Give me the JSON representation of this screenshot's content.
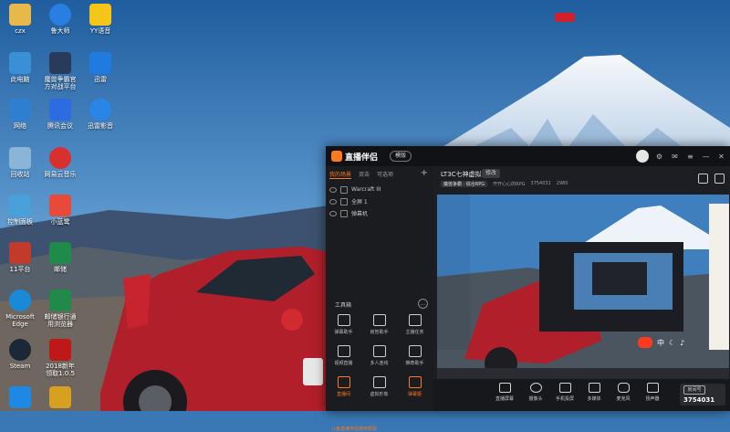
{
  "desktop": {
    "icons_col1": [
      {
        "label": "czx",
        "icon": "folder-icon",
        "color": "#e8b84b"
      },
      {
        "label": "此电脑",
        "icon": "computer-icon",
        "color": "#3a8fd6"
      },
      {
        "label": "网络",
        "icon": "network-icon",
        "color": "#2f7fd0"
      },
      {
        "label": "回收站",
        "icon": "recycle-bin-icon",
        "color": "#8ab4d8"
      },
      {
        "label": "控制面板",
        "icon": "control-panel-icon",
        "color": "#4aa0d8"
      },
      {
        "label": "11平台",
        "icon": "11-platform-icon",
        "color": "#c23b2a"
      },
      {
        "label": "Microsoft\nEdge",
        "icon": "edge-icon",
        "color": "#1a8ad8"
      },
      {
        "label": "Steam",
        "icon": "steam-icon",
        "color": "#1b2838"
      }
    ],
    "icons_col2": [
      {
        "label": "鲁大师",
        "icon": "ludashi-icon",
        "color": "#2a7de1"
      },
      {
        "label": "魔兽争霸官\n方对战平台",
        "icon": "warcraft-icon",
        "color": "#2a3a5a"
      },
      {
        "label": "腾讯会议",
        "icon": "tencent-meeting-icon",
        "color": "#2d6be0"
      },
      {
        "label": "网易云音乐",
        "icon": "netease-music-icon",
        "color": "#d8302f"
      },
      {
        "label": "小蓝鹭",
        "icon": "heron-icon",
        "color": "#e84a3a"
      },
      {
        "label": "邮储",
        "icon": "psbc-icon",
        "color": "#1f8a4a"
      },
      {
        "label": "邮储银行通\n用浏览器",
        "icon": "psbc-browser-icon",
        "color": "#1f8a4a"
      },
      {
        "label": "2018新年\n领取1.0.5",
        "icon": "new-year-icon",
        "color": "#c01818"
      }
    ],
    "icons_col3": [
      {
        "label": "YY语音",
        "icon": "yy-icon",
        "color": "#f5c518"
      },
      {
        "label": "迅雷",
        "icon": "thunder-icon",
        "color": "#1f7be0"
      },
      {
        "label": "迅雷影音",
        "icon": "thunder-player-icon",
        "color": "#2a86e6"
      }
    ],
    "taskbar_partial": [
      {
        "label": "",
        "icon": "qq-browser-icon",
        "color": "#1e88e5"
      },
      {
        "label": "",
        "icon": "csgo-icon",
        "color": "#d8a020"
      }
    ]
  },
  "app": {
    "name": "直播伴侣",
    "title_button": "模版",
    "tabs": [
      {
        "label": "我的场景",
        "active": true
      },
      {
        "label": "双击",
        "active": false
      },
      {
        "label": "可选项",
        "active": false
      }
    ],
    "scenes": [
      {
        "label": "Warcraft III"
      },
      {
        "label": "全屏 1"
      },
      {
        "label": "弹幕机"
      }
    ],
    "toolbox_title": "工具箱",
    "tools": [
      {
        "label": "弹幕助手",
        "hot": false
      },
      {
        "label": "房管助手",
        "hot": false
      },
      {
        "label": "主播任务",
        "hot": false
      },
      {
        "label": "视频直播",
        "hot": false
      },
      {
        "label": "多人连线",
        "hot": false
      },
      {
        "label": "推荐助手",
        "hot": false
      },
      {
        "label": "直播间",
        "hot": true
      },
      {
        "label": "虚拟形象",
        "hot": false
      },
      {
        "label": "弹幕姬",
        "hot": true
      }
    ],
    "bottom_note": "斗鱼直播伴侣使用帮助",
    "room": {
      "title": "LT3C七神虚拟",
      "tag": "修改",
      "category": "魔兽争霸 · 综合RPG",
      "meta1": "开开心心的RPG",
      "room_id": "3754031",
      "viewers": "2980"
    },
    "dock": [
      {
        "label": "直播屏幕"
      },
      {
        "label": "摄像头"
      },
      {
        "label": "手机投屏"
      },
      {
        "label": "多媒体"
      },
      {
        "label": "麦克风"
      },
      {
        "label": "扬声器"
      }
    ],
    "room_label": "房间号",
    "room_number": "3754031"
  },
  "ime": {
    "label": "中"
  }
}
